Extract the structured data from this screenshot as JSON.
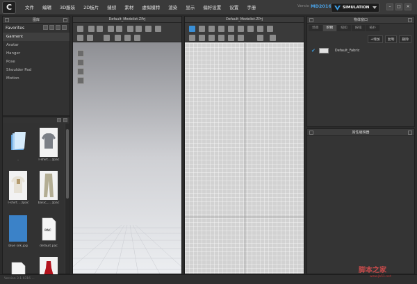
{
  "menu": {
    "items": [
      "文件",
      "编辑",
      "3D服装",
      "2D板片",
      "缝纫",
      "素材",
      "虚拟模特",
      "渲染",
      "显示",
      "偏好设置",
      "设置",
      "手册"
    ]
  },
  "header": {
    "version_label": "Versio",
    "version_value": "MD2016",
    "mode_label": "SIMULATION",
    "window_buttons": [
      "–",
      "□",
      "×"
    ]
  },
  "library": {
    "title": "图库",
    "favorites_label": "Favorites",
    "items": [
      {
        "label": "Garment"
      },
      {
        "label": "Avatar"
      },
      {
        "label": "Hanger"
      },
      {
        "label": "Pose"
      },
      {
        "label": "Shoulder Pad"
      },
      {
        "label": "Motion"
      }
    ],
    "thumbs": [
      {
        "caption": ".."
      },
      {
        "caption": "T-shirt....zpac"
      },
      {
        "caption": "T-shirt....zpac"
      },
      {
        "caption": "basic_....zpac"
      },
      {
        "caption": "blue silk.jpg"
      },
      {
        "caption": "default.pac"
      }
    ],
    "pac_label": "PAC",
    "status_text": "Version 3.1.0316 ..."
  },
  "viewports": {
    "view3d_title": "Default_Modelist.ZPrj",
    "view2d_title": "Default_Modelist.ZPrj"
  },
  "object_browser": {
    "title": "物体窗口",
    "tabs": [
      "场景",
      "织物",
      "纽扣",
      "按钮",
      "拓扑"
    ],
    "active_tab": 1,
    "add_label": "+增加",
    "copy_label": "复制",
    "delete_label": "删除",
    "fabric_name": "Default_Fabric",
    "check_glyph": "✔"
  },
  "property_editor": {
    "title": "属性编辑器"
  },
  "watermark": {
    "text": "脚本之家",
    "sub": "www.jb51.net"
  },
  "colors": {
    "accent": "#4aa3e8",
    "panel": "#343434",
    "background": "#2b2b2b"
  }
}
